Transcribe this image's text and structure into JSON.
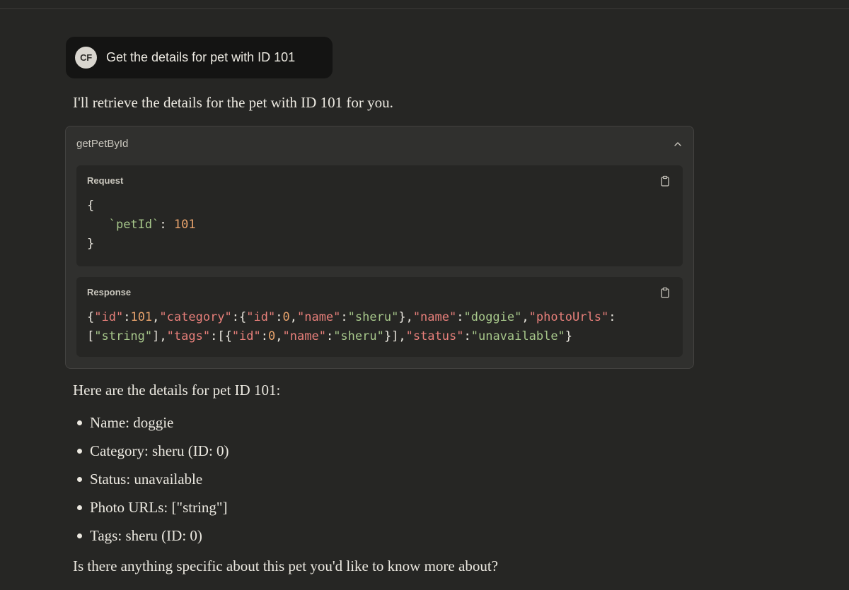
{
  "user_message": {
    "avatar_initials": "CF",
    "text": "Get the details for pet with ID 101"
  },
  "assistant": {
    "intro": "I'll retrieve the details for the pet with ID 101 for you.",
    "tool_call": {
      "name": "getPetById",
      "request": {
        "label": "Request",
        "open_brace": "{",
        "key": "`petId`",
        "colon": ": ",
        "value": "101",
        "close_brace": "}"
      },
      "response": {
        "label": "Response",
        "line1": "{\"id\":101,\"category\":{\"id\":0,\"name\":\"sheru\"},\"name\":\"doggie\",\"photoUrls\":",
        "line2": "[\"string\"],\"tags\":[{\"id\":0,\"name\":\"sheru\"}],\"status\":\"unavailable\"}"
      }
    },
    "summary": "Here are the details for pet ID 101:",
    "details": [
      "Name: doggie",
      "Category: sheru (ID: 0)",
      "Status: unavailable",
      "Photo URLs: [\"string\"]",
      "Tags: sheru (ID: 0)"
    ],
    "closing": "Is there anything specific about this pet you'd like to know more about?"
  },
  "colors": {
    "background": "#262624",
    "card": "#30302e",
    "json_key": "#e77f7a",
    "json_string": "#a6c68a",
    "json_number": "#e8a36c"
  },
  "icons": [
    "chevron-up-icon",
    "clipboard-icon"
  ]
}
